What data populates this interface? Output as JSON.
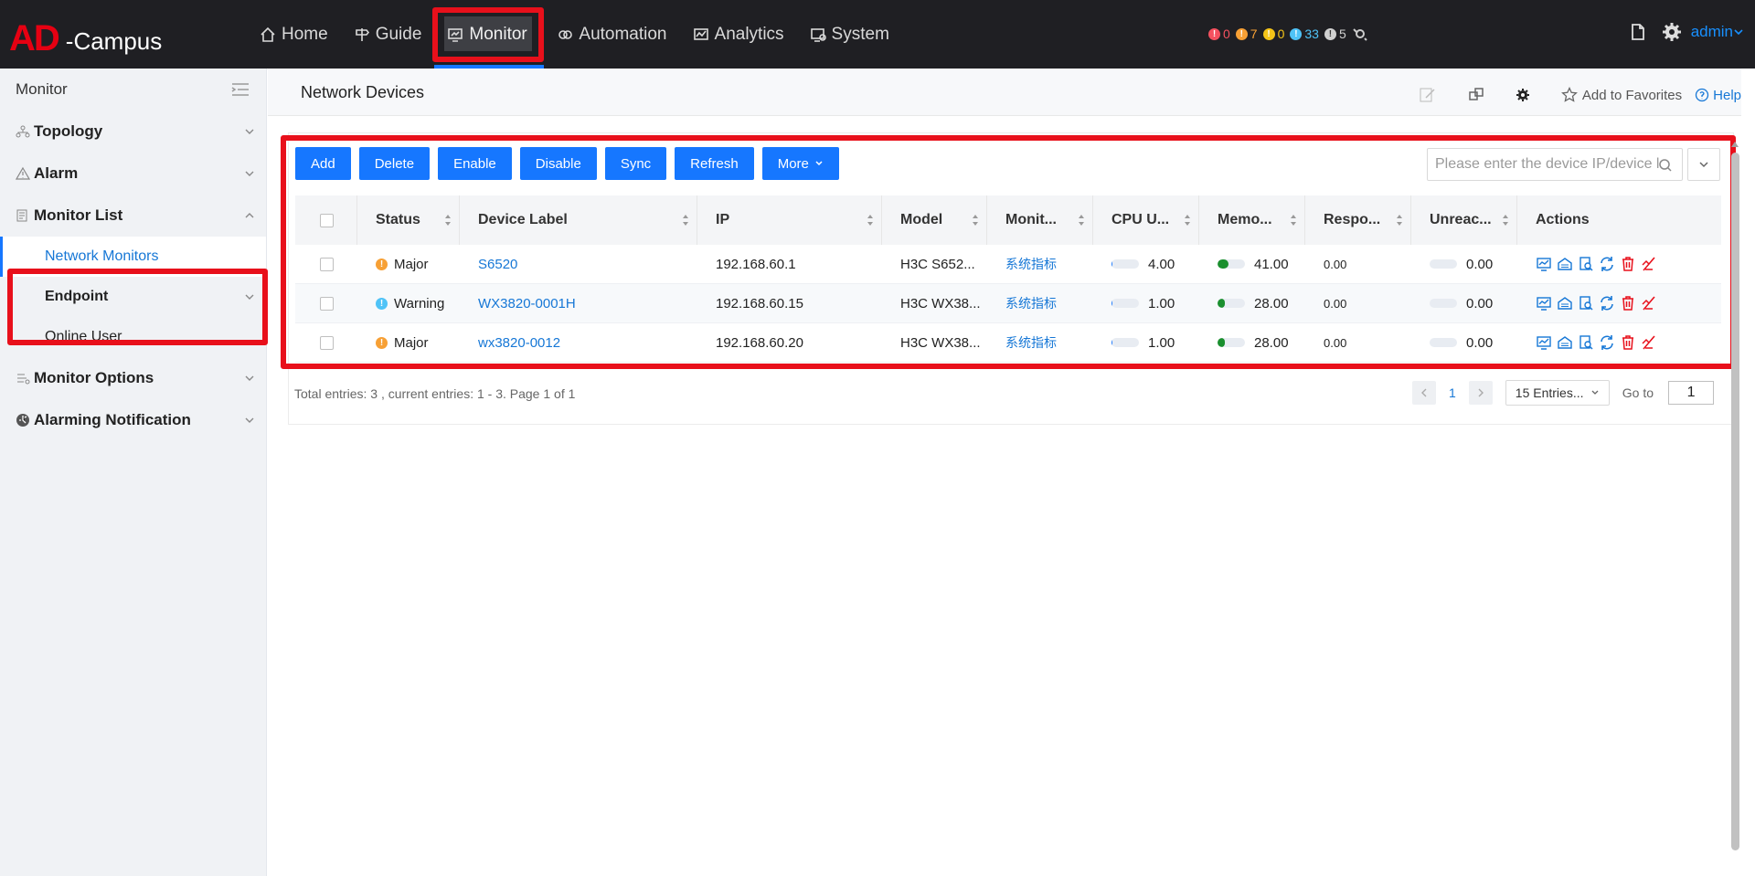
{
  "app": {
    "logo_ad": "AD",
    "logo_campus": "-Campus"
  },
  "nav": [
    {
      "label": "Home",
      "icon": "home-icon"
    },
    {
      "label": "Guide",
      "icon": "signpost-icon"
    },
    {
      "label": "Monitor",
      "icon": "monitor-icon",
      "active": true
    },
    {
      "label": "Automation",
      "icon": "automation-icon"
    },
    {
      "label": "Analytics",
      "icon": "analytics-icon"
    },
    {
      "label": "System",
      "icon": "system-icon"
    }
  ],
  "alarm_counts": [
    {
      "level": "critical",
      "count": "0",
      "color": "#f5515f"
    },
    {
      "level": "major",
      "count": "7",
      "color": "#f7a035"
    },
    {
      "level": "minor",
      "count": "0",
      "color": "#f5c518"
    },
    {
      "level": "warning",
      "count": "33",
      "color": "#4fc3f7"
    },
    {
      "level": "info",
      "count": "5",
      "color": "#d0d0d0"
    }
  ],
  "user": {
    "name": "admin"
  },
  "sidebar": {
    "title": "Monitor",
    "topology": "Topology",
    "alarm": "Alarm",
    "monitor_list": "Monitor List",
    "network_monitors": "Network Monitors",
    "endpoint": "Endpoint",
    "online_user": "Online User",
    "monitor_options": "Monitor Options",
    "alarming_notification": "Alarming Notification"
  },
  "page": {
    "title": "Network Devices",
    "add_to_favorites": "Add to Favorites",
    "help": "Help"
  },
  "toolbar": {
    "add": "Add",
    "delete": "Delete",
    "enable": "Enable",
    "disable": "Disable",
    "sync": "Sync",
    "refresh": "Refresh",
    "more": "More"
  },
  "search": {
    "placeholder": "Please enter the device IP/device label"
  },
  "table": {
    "columns": [
      "Status",
      "Device Label",
      "IP",
      "Model",
      "Monit...",
      "CPU U...",
      "Memo...",
      "Respo...",
      "Unreac...",
      "Actions"
    ],
    "rows": [
      {
        "status": "Major",
        "status_color": "#f7a035",
        "label": "S6520",
        "ip": "192.168.60.1",
        "model": "H3C S652...",
        "metric": "系统指标",
        "cpu": "4.00",
        "cpu_pct": 4,
        "mem": "41.00",
        "mem_pct": 41,
        "resp": "0.00",
        "unreach": "0.00"
      },
      {
        "status": "Warning",
        "status_color": "#4fc3f7",
        "label": "WX3820-0001H",
        "ip": "192.168.60.15",
        "model": "H3C WX38...",
        "metric": "系统指标",
        "cpu": "1.00",
        "cpu_pct": 1,
        "mem": "28.00",
        "mem_pct": 28,
        "resp": "0.00",
        "unreach": "0.00"
      },
      {
        "status": "Major",
        "status_color": "#f7a035",
        "label": "wx3820-0012",
        "ip": "192.168.60.20",
        "model": "H3C WX38...",
        "metric": "系统指标",
        "cpu": "1.00",
        "cpu_pct": 1,
        "mem": "28.00",
        "mem_pct": 28,
        "resp": "0.00",
        "unreach": "0.00"
      }
    ]
  },
  "footer": {
    "info": "Total entries: 3 , current entries: 1 - 3. Page 1 of 1",
    "page": "1",
    "page_size": "15 Entries...",
    "goto_label": "Go to",
    "goto_value": "1"
  },
  "colors": {
    "primary": "#1677ff",
    "highlight": "#e8101b",
    "memory_fill": "#1a8f2e"
  }
}
